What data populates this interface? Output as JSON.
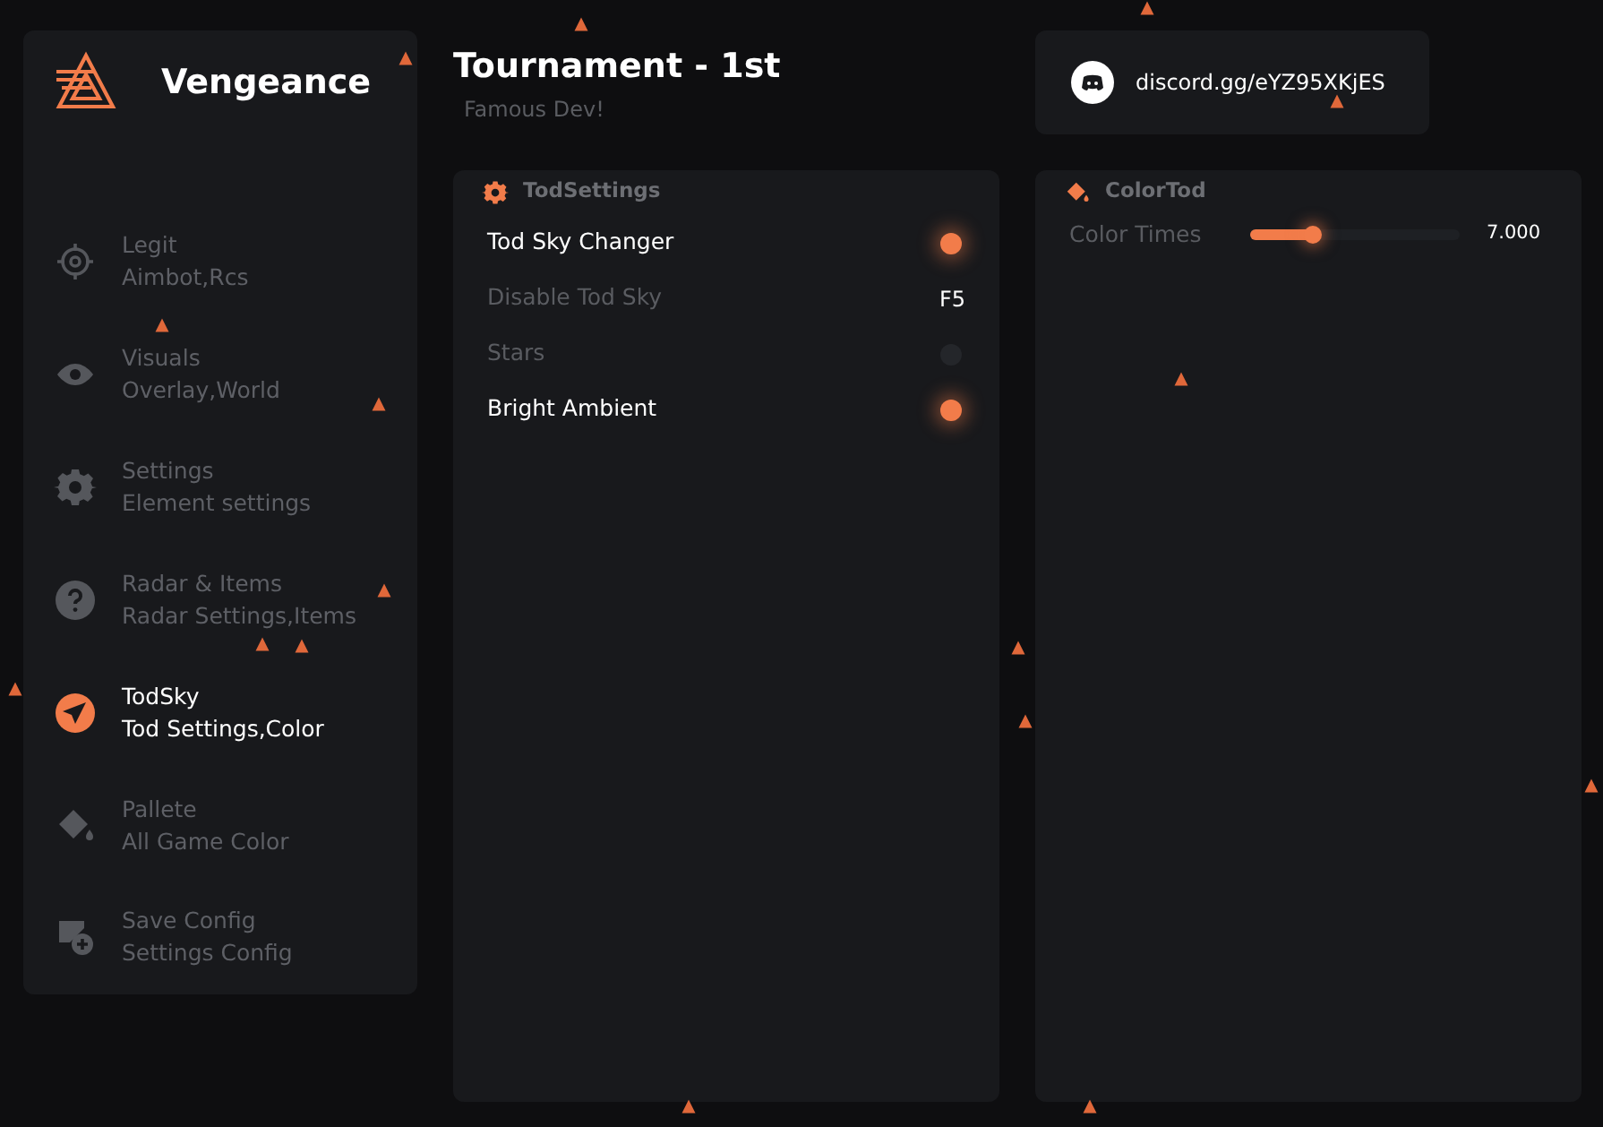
{
  "brand": {
    "name": "Vengeance"
  },
  "nav": [
    {
      "title": "Legit",
      "subtitle": "Aimbot,Rcs",
      "selected": false
    },
    {
      "title": "Visuals",
      "subtitle": "Overlay,World",
      "selected": false
    },
    {
      "title": "Settings",
      "subtitle": "Element settings",
      "selected": false
    },
    {
      "title": "Radar & Items",
      "subtitle": "Radar Settings,Items",
      "selected": false
    },
    {
      "title": "TodSky",
      "subtitle": "Tod Settings,Color",
      "selected": true
    },
    {
      "title": "Pallete",
      "subtitle": "All Game Color",
      "selected": false
    },
    {
      "title": "Save Config",
      "subtitle": "Settings Config",
      "selected": false
    }
  ],
  "header": {
    "title": "Tournament - 1st",
    "subtitle": "Famous Dev!"
  },
  "discord": {
    "link": "discord.gg/eYZ95XKjES"
  },
  "panels": [
    {
      "title": "TodSettings",
      "rows": [
        {
          "kind": "toggle",
          "label": "Tod Sky Changer",
          "on": true
        },
        {
          "kind": "keybind",
          "label": "Disable Tod Sky",
          "key": "F5",
          "on": false
        },
        {
          "kind": "toggle",
          "label": "Stars",
          "on": false
        },
        {
          "kind": "toggle",
          "label": "Bright Ambient",
          "on": true
        }
      ]
    },
    {
      "title": "ColorTod",
      "rows": [
        {
          "kind": "slider",
          "label": "Color Times",
          "level": 0.3,
          "reading": "7.000"
        }
      ]
    }
  ]
}
